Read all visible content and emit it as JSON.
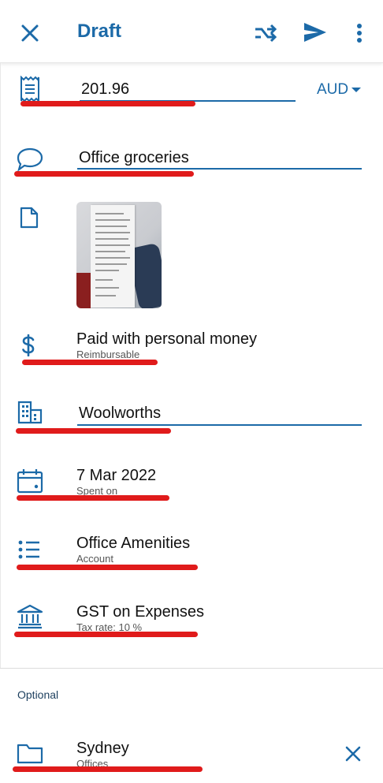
{
  "appbar": {
    "title": "Draft",
    "icons": [
      "close-icon",
      "shuffle-icon",
      "send-icon",
      "more-vert-icon"
    ]
  },
  "amount": {
    "value": "201.96",
    "currency": "AUD"
  },
  "description": {
    "value": "Office groceries"
  },
  "merchant": {
    "value": "Woolworths"
  },
  "payment": {
    "title": "Paid with personal money",
    "subtitle": "Reimbursable"
  },
  "date": {
    "value": "7 Mar 2022",
    "label": "Spent on"
  },
  "account": {
    "value": "Office Amenities",
    "label": "Account"
  },
  "tax": {
    "value": "GST on Expenses",
    "label": "Tax rate: 10 %"
  },
  "optional_section": {
    "heading": "Optional",
    "location": {
      "value": "Sydney",
      "label": "Offices"
    }
  },
  "colors": {
    "accent": "#1c6aa8",
    "annotation": "#e01b1b"
  }
}
